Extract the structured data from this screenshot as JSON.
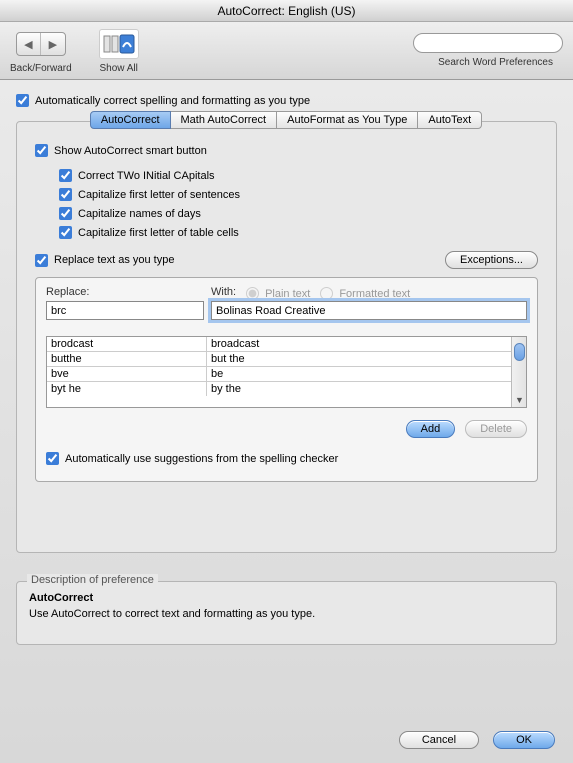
{
  "title": "AutoCorrect: English (US)",
  "toolbar": {
    "backforward_label": "Back/Forward",
    "showall_label": "Show All",
    "search_placeholder": "",
    "search_label": "Search Word Preferences"
  },
  "top_checkbox": "Automatically correct spelling and formatting as you type",
  "tabs": [
    "AutoCorrect",
    "Math AutoCorrect",
    "AutoFormat as You Type",
    "AutoText"
  ],
  "options": {
    "show_smart_button": "Show AutoCorrect smart button",
    "correct_two": "Correct TWo INitial CApitals",
    "cap_sentences": "Capitalize first letter of sentences",
    "cap_days": "Capitalize names of days",
    "cap_table": "Capitalize first letter of table cells",
    "replace_as_type": "Replace text as you type",
    "exceptions": "Exceptions...",
    "auto_suggest": "Automatically use suggestions from the spelling checker"
  },
  "replace": {
    "replace_header": "Replace:",
    "with_header": "With:",
    "plain_text": "Plain text",
    "formatted_text": "Formatted text",
    "replace_value": "brc",
    "with_value": "Bolinas Road Creative",
    "rows": [
      {
        "a": "brodcast",
        "b": "broadcast"
      },
      {
        "a": "butthe",
        "b": "but the"
      },
      {
        "a": "bve",
        "b": "be"
      },
      {
        "a": "byt he",
        "b": "by the"
      }
    ],
    "add": "Add",
    "delete": "Delete"
  },
  "description": {
    "label": "Description of preference",
    "head": "AutoCorrect",
    "body": "Use AutoCorrect to correct text and formatting as you type."
  },
  "footer": {
    "cancel": "Cancel",
    "ok": "OK"
  }
}
